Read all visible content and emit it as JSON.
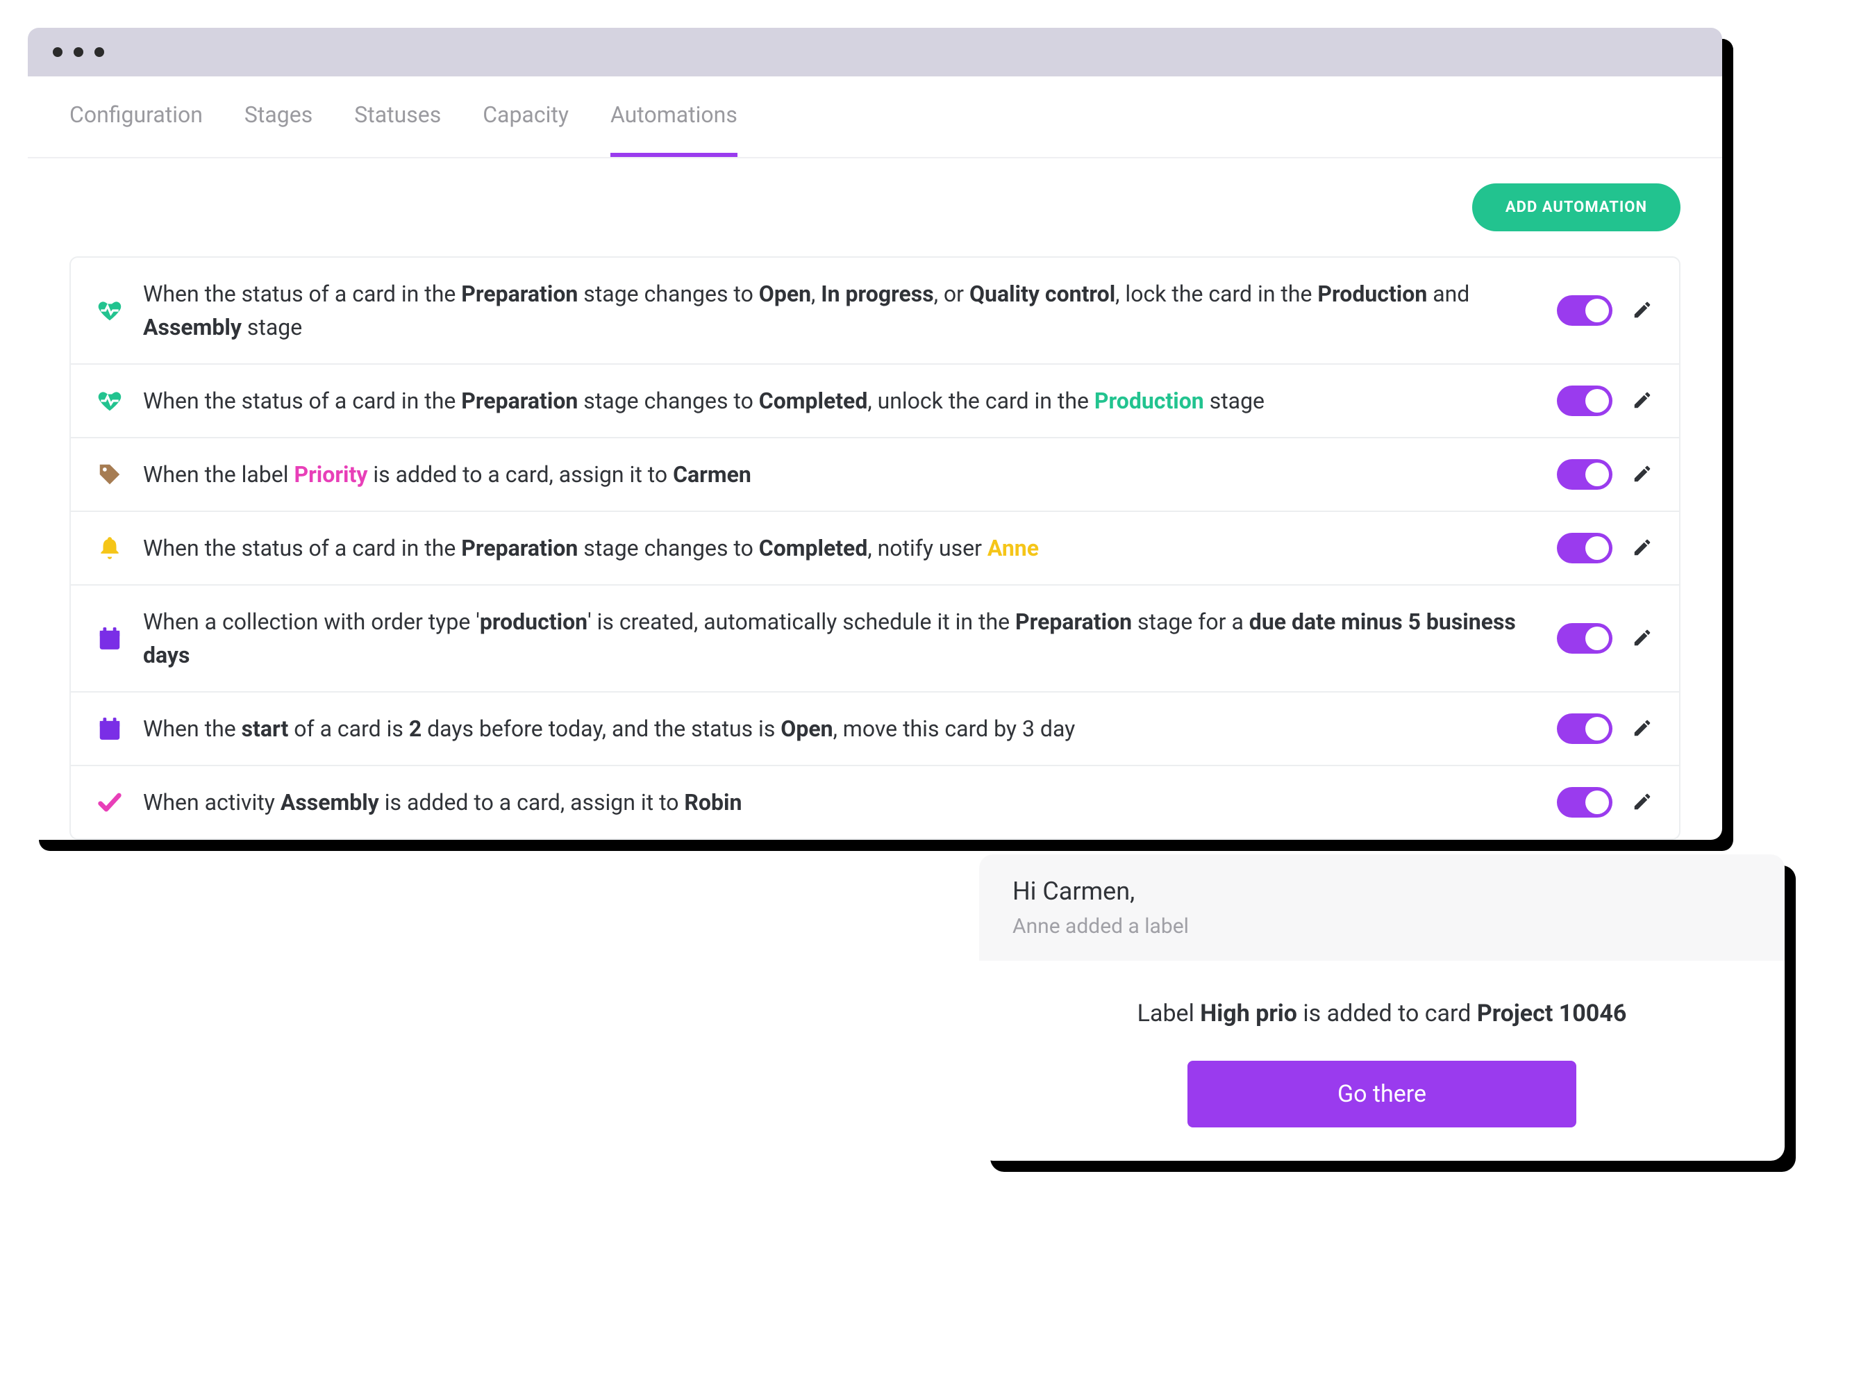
{
  "tabs": [
    {
      "label": "Configuration",
      "active": false
    },
    {
      "label": "Stages",
      "active": false
    },
    {
      "label": "Statuses",
      "active": false
    },
    {
      "label": "Capacity",
      "active": false
    },
    {
      "label": "Automations",
      "active": true
    }
  ],
  "toolbar": {
    "add_label": "ADD AUTOMATION"
  },
  "automations": [
    {
      "icon": "heartbeat",
      "icon_color": "#22c38f",
      "segments": [
        {
          "t": "When the status of a card in the "
        },
        {
          "t": "Preparation",
          "b": true
        },
        {
          "t": " stage changes to "
        },
        {
          "t": "Open",
          "b": true
        },
        {
          "t": ", "
        },
        {
          "t": "In progress",
          "b": true
        },
        {
          "t": ", or "
        },
        {
          "t": "Quality control",
          "b": true
        },
        {
          "t": ", lock the card in the "
        },
        {
          "t": "Production",
          "b": true
        },
        {
          "t": " and "
        },
        {
          "t": "Assembly",
          "b": true
        },
        {
          "t": " stage"
        }
      ]
    },
    {
      "icon": "heartbeat",
      "icon_color": "#22c38f",
      "segments": [
        {
          "t": "When the status of a card in the "
        },
        {
          "t": "Preparation",
          "b": true
        },
        {
          "t": " stage changes to "
        },
        {
          "t": "Completed",
          "b": true
        },
        {
          "t": ", unlock the card in the "
        },
        {
          "t": "Production",
          "b": true,
          "color": "#22c38f"
        },
        {
          "t": " stage"
        }
      ]
    },
    {
      "icon": "tag",
      "icon_color": "#a67c52",
      "segments": [
        {
          "t": "When the label "
        },
        {
          "t": "Priority",
          "b": true,
          "color": "#e83fb8"
        },
        {
          "t": " is added to a card, assign it to "
        },
        {
          "t": "Carmen",
          "b": true
        }
      ]
    },
    {
      "icon": "bell",
      "icon_color": "#f5c518",
      "segments": [
        {
          "t": "When the status of a card in the "
        },
        {
          "t": "Preparation",
          "b": true
        },
        {
          "t": " stage changes to "
        },
        {
          "t": "Completed",
          "b": true
        },
        {
          "t": ", notify user "
        },
        {
          "t": "Anne",
          "b": true,
          "color": "#f5c518"
        }
      ]
    },
    {
      "icon": "calendar",
      "icon_color": "#7a2ee6",
      "segments": [
        {
          "t": "When a collection with order type '"
        },
        {
          "t": "production",
          "b": true
        },
        {
          "t": "' is created, automatically schedule it in the "
        },
        {
          "t": "Preparation",
          "b": true
        },
        {
          "t": " stage for a "
        },
        {
          "t": "due date minus 5 business days",
          "b": true
        }
      ]
    },
    {
      "icon": "calendar",
      "icon_color": "#7a2ee6",
      "segments": [
        {
          "t": "When the "
        },
        {
          "t": "start",
          "b": true
        },
        {
          "t": " of a card is "
        },
        {
          "t": "2",
          "b": true
        },
        {
          "t": " days before today, and the status is "
        },
        {
          "t": "Open",
          "b": true
        },
        {
          "t": ", move this card by 3 day"
        }
      ]
    },
    {
      "icon": "check",
      "icon_color": "#e83fb8",
      "segments": [
        {
          "t": "When activity "
        },
        {
          "t": "Assembly",
          "b": true
        },
        {
          "t": " is added to a card, assign it to "
        },
        {
          "t": "Robin",
          "b": true
        }
      ]
    }
  ],
  "notification": {
    "greeting": "Hi Carmen,",
    "subtitle": "Anne added a label",
    "message_pre": "Label ",
    "message_label": "High prio",
    "message_mid": " is added to card ",
    "message_card": "Project 10046",
    "button": "Go there"
  },
  "colors": {
    "accent": "#9a3bee",
    "green": "#22c38f"
  }
}
